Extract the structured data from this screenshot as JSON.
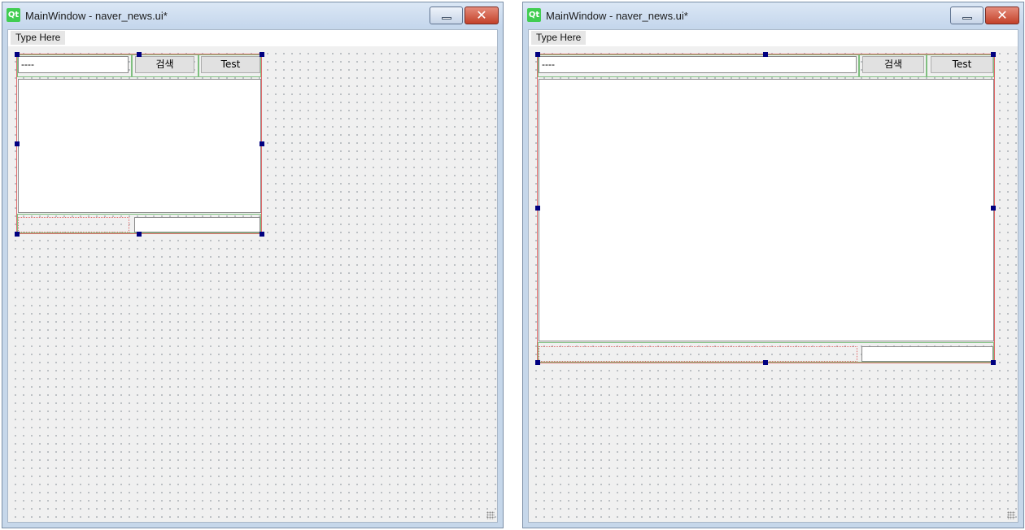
{
  "windows": [
    {
      "title": "MainWindow - naver_news.ui*",
      "logo_text": "Qt",
      "menu": {
        "placeholder_item": "Type Here"
      },
      "form": {
        "line_edit_text": "----",
        "search_button_label": "검색",
        "test_button_label": "Test"
      }
    },
    {
      "title": "MainWindow - naver_news.ui*",
      "logo_text": "Qt",
      "menu": {
        "placeholder_item": "Type Here"
      },
      "form": {
        "line_edit_text": "----",
        "search_button_label": "검색",
        "test_button_label": "Test"
      }
    }
  ],
  "icons": {
    "minimize": "minimize-icon",
    "close": "close-icon",
    "app": "qt-logo-icon",
    "resize_grip": "resize-grip-icon"
  },
  "colors": {
    "selection_handle": "#000080",
    "layout_border": "#e06b6b",
    "close_button": "#c3412a",
    "qt_green": "#41cd52"
  }
}
